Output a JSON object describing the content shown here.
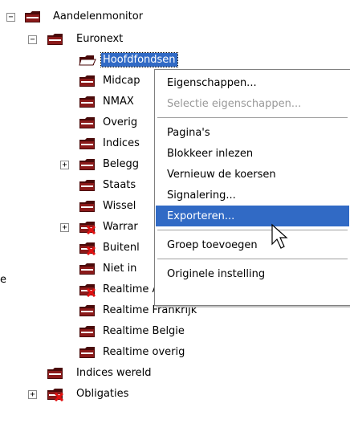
{
  "tree": {
    "nodes": [
      {
        "label": "Aandelenmonitor",
        "icon": "folder-icon",
        "expander": "−"
      },
      {
        "label": "Euronext",
        "icon": "folder-icon",
        "expander": "−"
      },
      {
        "label": "Hoofdfondsen",
        "icon": "open-folder-icon",
        "selected": true
      },
      {
        "label": "Midcap",
        "icon": "folder-icon"
      },
      {
        "label": "NMAX",
        "icon": "folder-icon"
      },
      {
        "label": "Overig",
        "icon": "folder-icon"
      },
      {
        "label": "Indices",
        "icon": "folder-icon"
      },
      {
        "label": "Belegg",
        "icon": "folder-icon",
        "expander": "+"
      },
      {
        "label": "Staats",
        "icon": "folder-icon"
      },
      {
        "label": "Wissel",
        "icon": "folder-icon"
      },
      {
        "label": "Warrar",
        "icon": "folder-x-icon",
        "expander": "+"
      },
      {
        "label": "Buitenl",
        "icon": "folder-x-icon"
      },
      {
        "label": "Niet in",
        "icon": "folder-icon"
      },
      {
        "label": "Realtime AEX",
        "icon": "folder-x-icon"
      },
      {
        "label": "Realtime Frankrijk",
        "icon": "folder-icon"
      },
      {
        "label": "Realtime Belgie",
        "icon": "folder-icon"
      },
      {
        "label": "Realtime overig",
        "icon": "folder-icon"
      },
      {
        "label": "Indices wereld",
        "icon": "folder-icon"
      },
      {
        "label": "Obligaties",
        "icon": "folder-x-icon",
        "expander": "+"
      }
    ]
  },
  "context_menu": {
    "items": [
      {
        "label": "Eigenschappen...",
        "disabled": false
      },
      {
        "label": "Selectie eigenschappen...",
        "disabled": true
      },
      {
        "separator": true
      },
      {
        "label": "Pagina's",
        "disabled": false
      },
      {
        "label": "Blokkeer inlezen",
        "disabled": false
      },
      {
        "label": "Vernieuw de koersen",
        "disabled": false
      },
      {
        "label": "Signalering...",
        "disabled": false
      },
      {
        "label": "Exporteren...",
        "disabled": false,
        "highlighted": true
      },
      {
        "separator": true
      },
      {
        "label": "Groep toevoegen",
        "disabled": false
      },
      {
        "separator": true
      },
      {
        "label": "Originele instelling",
        "disabled": false
      }
    ]
  },
  "edge_text": "e",
  "colors": {
    "folder": "#8b1a1a",
    "folder_dark": "#4a0a0a",
    "selection": "#316ac5",
    "x_mark": "#e01010"
  }
}
